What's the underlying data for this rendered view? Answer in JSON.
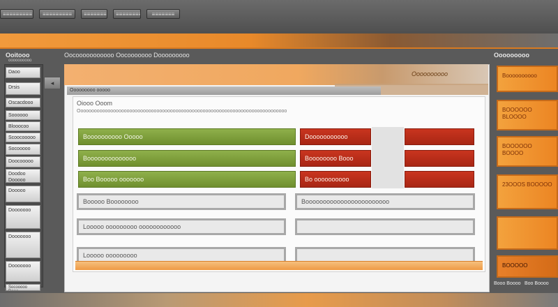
{
  "topbar": {
    "buttons": [
      "≡≡≡≡≡≡≡≡≡",
      "≡≡≡≡≡≡≡≡≡",
      "≡≡≡≡≡≡≡",
      "≡≡≡≡≡≡≡≡≡",
      "≡≡≡≡≡≡≡"
    ]
  },
  "left": {
    "title": "Ooitooo",
    "subtitle": "oooooooooo",
    "items": [
      "Daoo",
      "Drsis",
      "Oscacdooo",
      "Soooooo",
      "Blooocoo",
      "Scoocooooo",
      "Socooooo",
      "Doocooooo",
      "Doodoo Dooooo",
      "Dooooo",
      "Dooooooo",
      "Dooooooo",
      "Dooooooo",
      "Socooooo Dooo"
    ]
  },
  "breadcrumb": "Oocooooooooooo Oocooooooo Dooooooooo",
  "header": {
    "title": "Oooooooooo"
  },
  "section": {
    "label": "Ooooooooo ooooo"
  },
  "form": {
    "title": "Oiooo Ooom",
    "description": "Ooooooooooooooooooooooooooooooooooooooooooooooooooooooooooooooooooooooooooooo",
    "rows": [
      {
        "left": "Boooooooooo Ooooo",
        "mid": "Dooooooooooo",
        "right": ""
      },
      {
        "left": "Boooooooooooooo",
        "mid": "Boooooooo Booo",
        "right": ""
      },
      {
        "left": "Boo Booooo ooooooo",
        "mid": "Bo oooooooooo",
        "right": ""
      },
      {
        "left": "Booooo Boooooooo",
        "right_wide": "Boooooooooooooooooooooooo"
      },
      {
        "left": "Looooo ooooooooo oooooooooooo",
        "right_wide": ""
      },
      {
        "left": "Looooo ooooooooo",
        "right_wide": ""
      }
    ]
  },
  "right": {
    "title": "Ooooooooo",
    "tiles": [
      "Boooooooooo",
      "BOOOOOO BLOOOO",
      "BOOOOOO BOOOO",
      "23OOOS BOOOOO",
      "",
      "BOOOOO"
    ],
    "footer_left": "Booo Boooo",
    "footer_right": "Boo Boooo"
  },
  "colors": {
    "accent_orange": "#ec8523",
    "green": "#7c9d3a",
    "red": "#b82d18"
  },
  "icons": {
    "collapse": "arrow-left-icon"
  }
}
